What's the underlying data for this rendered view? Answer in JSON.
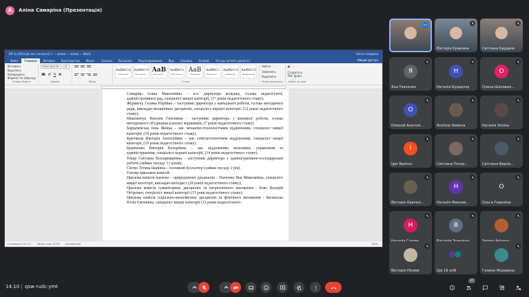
{
  "presenter": {
    "initial": "А",
    "label": "Аліна Самаріна (Презентація)"
  },
  "word": {
    "title": "ВП за 2024 рік (всі питання) 1 — копия — копия — Word",
    "user": "Аліна Самаріна",
    "tabs": [
      "Файл",
      "Главная",
      "Вставка",
      "Конструктор",
      "Макет",
      "Ссылки",
      "Рассылки",
      "Рецензирование",
      "Вид",
      "Справка",
      "Acrobat",
      "Что вы хотите сделать?"
    ],
    "share": "Общий доступ",
    "font_name": "Times New Ro",
    "font_size": "14",
    "groups": [
      "Буфер обмена",
      "Шрифт",
      "Абзац",
      "Стили",
      "Редактирование",
      "Adobe Acrobat"
    ],
    "ribbon_left": [
      "Вырезать",
      "Копировать",
      "Формат по образцу",
      "Вставить"
    ],
    "edit_items": [
      "Найти",
      "Заменить",
      "Выделить"
    ],
    "acrobat_label": "Создать и PDF-файл",
    "styles": [
      {
        "sample": "AaBbCcI",
        "name": "Обычный"
      },
      {
        "sample": "AaBbCcI",
        "name": "Без инте..."
      },
      {
        "sample": "AaB",
        "name": "Заголово..."
      },
      {
        "sample": "AaBbCo",
        "name": "Заголово..."
      },
      {
        "sample": "AaB",
        "name": "Название"
      },
      {
        "sample": "AaBbCc",
        "name": "Подзагол..."
      },
      {
        "sample": "AaBbCcI",
        "name": "Слабое в..."
      },
      {
        "sample": "AaBbCcI",
        "name": "Выделение"
      }
    ],
    "paragraphs": [
      "Самаріна Аліна Миколаївна – в.о. директора коледжу, голова педагогічної, адміністративної рад, спеціаліст вищої категорії, (17 років педагогічного стажу).",
      "Журавель Галина Юріївна – заступник директора з навчальної роботи, голова методичної ради, викладач механічних дисциплін, спеціаліст першої категорії, (12 років педагогічного стажу).",
      "Максимчук Наталія Євгенівна – заступник директора з виховної роботи, голова методичного об'єднання класних керівників, (7 років педагогічного стажу).",
      "Бардачевська Інна Яківна – зав. механіко-технологічним відділенням, спеціаліст вищої категорії, (18 років педагогічного стажу).",
      "Крючкова Вікторія Анатоліївна – зав. електротехнічним відділенням, спеціаліст вищої категорії, (19 років педагогічного стажу).",
      "Кравченко Вікторія Валеріївна – зав. відділенням економіки, управління та адміністрування, спеціаліст першої категорії, (14 років педагогічного стажу).",
      "Токар Світлана Володимирівна – заступник директора з адміністративно-господарської роботи (займає посаду 13 років).",
      "Світко Тетяна Іванівна – головний бухгалтер (займає посаду 2 рік).",
      "Голови циклових комісій:",
      "Циклова комісія науково – природничих дисциплін - Ткаченко Яна Миколаївна, спеціаліст вищої категорії, викладач-методист (29 років педагогічного стажу);",
      "Циклова комісія гуманітарних дисциплін та патріотичного виховання - Бовс Валерій Петрович, спеціаліст вищої категорії (33 роки педагогічного стажу);",
      "Циклова комісія соціально-економічних дисциплін та фізичного виховання - Баганська Юлія Євгенівна, спеціаліст вищої категорії (13 років педагогічного"
    ],
    "status": [
      "Страница 3 из 117",
      "Число слов: 25931",
      "украинский"
    ],
    "zoom": "100%"
  },
  "participants": [
    {
      "name": "",
      "kind": "video",
      "speaking": true,
      "color": "#8c7b70"
    },
    {
      "name": "Вікторія Кравченко",
      "kind": "video",
      "color": "#7a8796"
    },
    {
      "name": "Світлана Бардачевська",
      "kind": "video",
      "color": "#8a7f78"
    },
    {
      "name": "Яна Ткаченко",
      "initial": "Я",
      "color": "#5f6368",
      "kind": "avatar"
    },
    {
      "name": "Наталія Бударпор...",
      "initial": "Н",
      "color": "#3f51b5",
      "kind": "avatar"
    },
    {
      "name": "Олена Шаповал...",
      "initial": "О",
      "color": "#e91e63",
      "kind": "avatar"
    },
    {
      "name": "Олексій Анатолі...",
      "initial": "О",
      "color": "#3f51b5",
      "kind": "avatar"
    },
    {
      "name": "Anzhela Yeskova",
      "kind": "photo",
      "color": "#6b5b4f"
    },
    {
      "name": "Наталія Зонїна",
      "kind": "photo",
      "color": "#5a4a45"
    },
    {
      "name": "Igor Barinov",
      "initial": "I",
      "color": "#f4511e",
      "kind": "avatar"
    },
    {
      "name": "Світлана Погро...",
      "kind": "photo",
      "color": "#7a6a60"
    },
    {
      "name": "Світлана Верліс...",
      "kind": "photo",
      "color": "#4a5a6a"
    },
    {
      "name": "Вікторія Крючко...",
      "kind": "photo",
      "color": "#6a6050"
    },
    {
      "name": "Наталія Максим...",
      "initial": "Н",
      "color": "#5e35b1",
      "kind": "avatar"
    },
    {
      "name": "Ольга Горюхіна",
      "initial": "О",
      "color": "#3c4043",
      "kind": "avatar"
    },
    {
      "name": "Наталія Сухова",
      "initial": "Н",
      "color": "#d81b60",
      "kind": "avatar"
    },
    {
      "name": "Вікторія Зозюліна",
      "initial": "В",
      "color": "#5f6f85",
      "kind": "avatar"
    },
    {
      "name": "Sergey Astapov",
      "kind": "photo",
      "color": "#b06030"
    },
    {
      "name": "Вікторія Нісеюк",
      "kind": "photo",
      "color": "#c4b7a0"
    },
    {
      "name": "Ще 16 осіб",
      "kind": "more"
    },
    {
      "name": "Галина Журавель",
      "kind": "photo",
      "color": "#3a8b8b"
    }
  ],
  "bottom": {
    "time": "14:10",
    "meeting_code": "qsw-rudc-ymt",
    "participant_count": "37"
  }
}
